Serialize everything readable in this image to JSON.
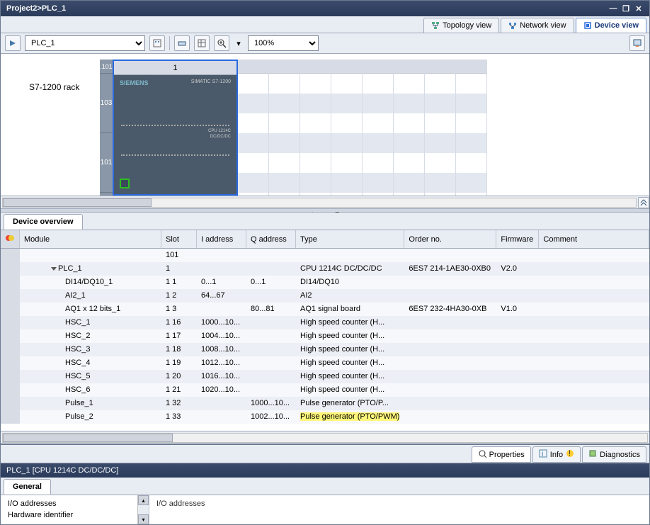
{
  "titlebar": {
    "path": "Project2>PLC_1"
  },
  "view_tabs": {
    "topology": "Topology view",
    "network": "Network view",
    "device": "Device view"
  },
  "toolbar": {
    "device_options": [
      "PLC_1"
    ],
    "zoom_options": [
      "100%"
    ],
    "zoom_value": "100%"
  },
  "rack": {
    "label": "S7-1200 rack",
    "slot101": ".101",
    "slot1": "1",
    "side103": "103",
    "side101": "101",
    "siemens": "SIEMENS",
    "simatic": "SIMATIC S7-1200",
    "cpu_line1": "CPU 1214C",
    "cpu_line2": "DC/DC/DC"
  },
  "overview": {
    "tab": "Device overview",
    "cols": {
      "module": "Module",
      "slot": "Slot",
      "iaddr": "I address",
      "qaddr": "Q address",
      "type": "Type",
      "order": "Order no.",
      "fw": "Firmware",
      "comment": "Comment"
    },
    "rows": [
      {
        "indent": 0,
        "module": "",
        "slot": "101",
        "iaddr": "",
        "qaddr": "",
        "type": "",
        "order": "",
        "fw": "",
        "comment": ""
      },
      {
        "indent": 1,
        "expander": "down",
        "module": "PLC_1",
        "slot": "1",
        "iaddr": "",
        "qaddr": "",
        "type": "CPU 1214C DC/DC/DC",
        "order": "6ES7 214-1AE30-0XB0",
        "fw": "V2.0",
        "comment": ""
      },
      {
        "indent": 2,
        "module": "DI14/DQ10_1",
        "slot": "1 1",
        "iaddr": "0...1",
        "qaddr": "0...1",
        "type": "DI14/DQ10",
        "order": "",
        "fw": "",
        "comment": ""
      },
      {
        "indent": 2,
        "module": "AI2_1",
        "slot": "1 2",
        "iaddr": "64...67",
        "qaddr": "",
        "type": "AI2",
        "order": "",
        "fw": "",
        "comment": ""
      },
      {
        "indent": 2,
        "module": "AQ1 x 12 bits_1",
        "slot": "1 3",
        "iaddr": "",
        "qaddr": "80...81",
        "type": "AQ1 signal board",
        "order": "6ES7 232-4HA30-0XB",
        "fw": "V1.0",
        "comment": ""
      },
      {
        "indent": 2,
        "module": "HSC_1",
        "slot": "1 16",
        "iaddr": "1000...10...",
        "qaddr": "",
        "type": "High speed counter (H...",
        "order": "",
        "fw": "",
        "comment": ""
      },
      {
        "indent": 2,
        "module": "HSC_2",
        "slot": "1 17",
        "iaddr": "1004...10...",
        "qaddr": "",
        "type": "High speed counter (H...",
        "order": "",
        "fw": "",
        "comment": ""
      },
      {
        "indent": 2,
        "module": "HSC_3",
        "slot": "1 18",
        "iaddr": "1008...10...",
        "qaddr": "",
        "type": "High speed counter (H...",
        "order": "",
        "fw": "",
        "comment": ""
      },
      {
        "indent": 2,
        "module": "HSC_4",
        "slot": "1 19",
        "iaddr": "1012...10...",
        "qaddr": "",
        "type": "High speed counter (H...",
        "order": "",
        "fw": "",
        "comment": ""
      },
      {
        "indent": 2,
        "module": "HSC_5",
        "slot": "1 20",
        "iaddr": "1016...10...",
        "qaddr": "",
        "type": "High speed counter (H...",
        "order": "",
        "fw": "",
        "comment": ""
      },
      {
        "indent": 2,
        "module": "HSC_6",
        "slot": "1 21",
        "iaddr": "1020...10...",
        "qaddr": "",
        "type": "High speed counter (H...",
        "order": "",
        "fw": "",
        "comment": ""
      },
      {
        "indent": 2,
        "module": "Pulse_1",
        "slot": "1 32",
        "iaddr": "",
        "qaddr": "1000...10...",
        "type": "Pulse generator (PTO/P...",
        "order": "",
        "fw": "",
        "comment": ""
      },
      {
        "indent": 2,
        "module": "Pulse_2",
        "slot": "1 33",
        "iaddr": "",
        "qaddr": "1002...10...",
        "type": "Pulse generator (PTO/PWM)",
        "order": "",
        "fw": "",
        "comment": "",
        "highlight_type": true
      }
    ]
  },
  "bottom": {
    "title": "PLC_1 [CPU 1214C DC/DC/DC]",
    "tabs": {
      "properties": "Properties",
      "info": "Info",
      "diagnostics": "Diagnostics"
    },
    "general_tab": "General",
    "nav": {
      "io": "I/O addresses",
      "hwid": "Hardware identifier"
    },
    "field_label": "I/O addresses"
  }
}
